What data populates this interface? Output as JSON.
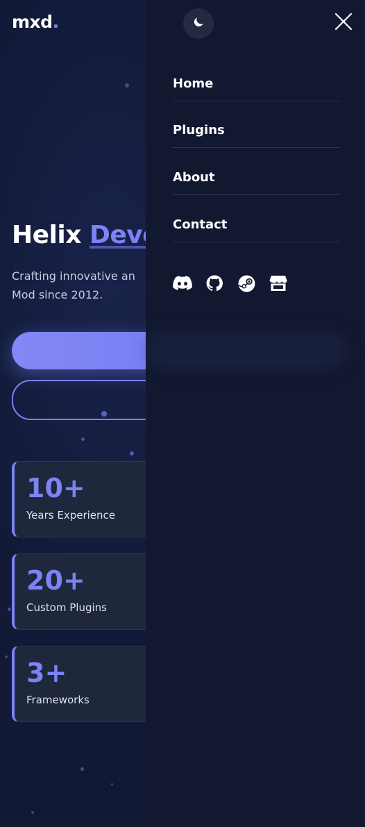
{
  "header": {
    "logo_text": "mxd",
    "logo_dot": ".",
    "theme_icon": "moon-icon",
    "close_icon": "close-icon"
  },
  "hero": {
    "title_plain": "Helix ",
    "title_accent": "Deve",
    "description_line1": "Crafting innovative an",
    "description_line2": "Mod since 2012."
  },
  "stats": [
    {
      "value": "10+",
      "label": "Years Experience"
    },
    {
      "value": "20+",
      "label": "Custom Plugins"
    },
    {
      "value": "3+",
      "label": "Frameworks"
    }
  ],
  "menu": {
    "items": [
      {
        "label": "Home"
      },
      {
        "label": "Plugins"
      },
      {
        "label": "About"
      },
      {
        "label": "Contact"
      }
    ],
    "social": [
      {
        "name": "discord-icon"
      },
      {
        "name": "github-icon"
      },
      {
        "name": "steam-icon"
      },
      {
        "name": "store-icon"
      }
    ]
  },
  "colors": {
    "accent": "#7c83f5",
    "background": "#111830",
    "menu_background": "#121830",
    "card_background": "#1e273b"
  }
}
